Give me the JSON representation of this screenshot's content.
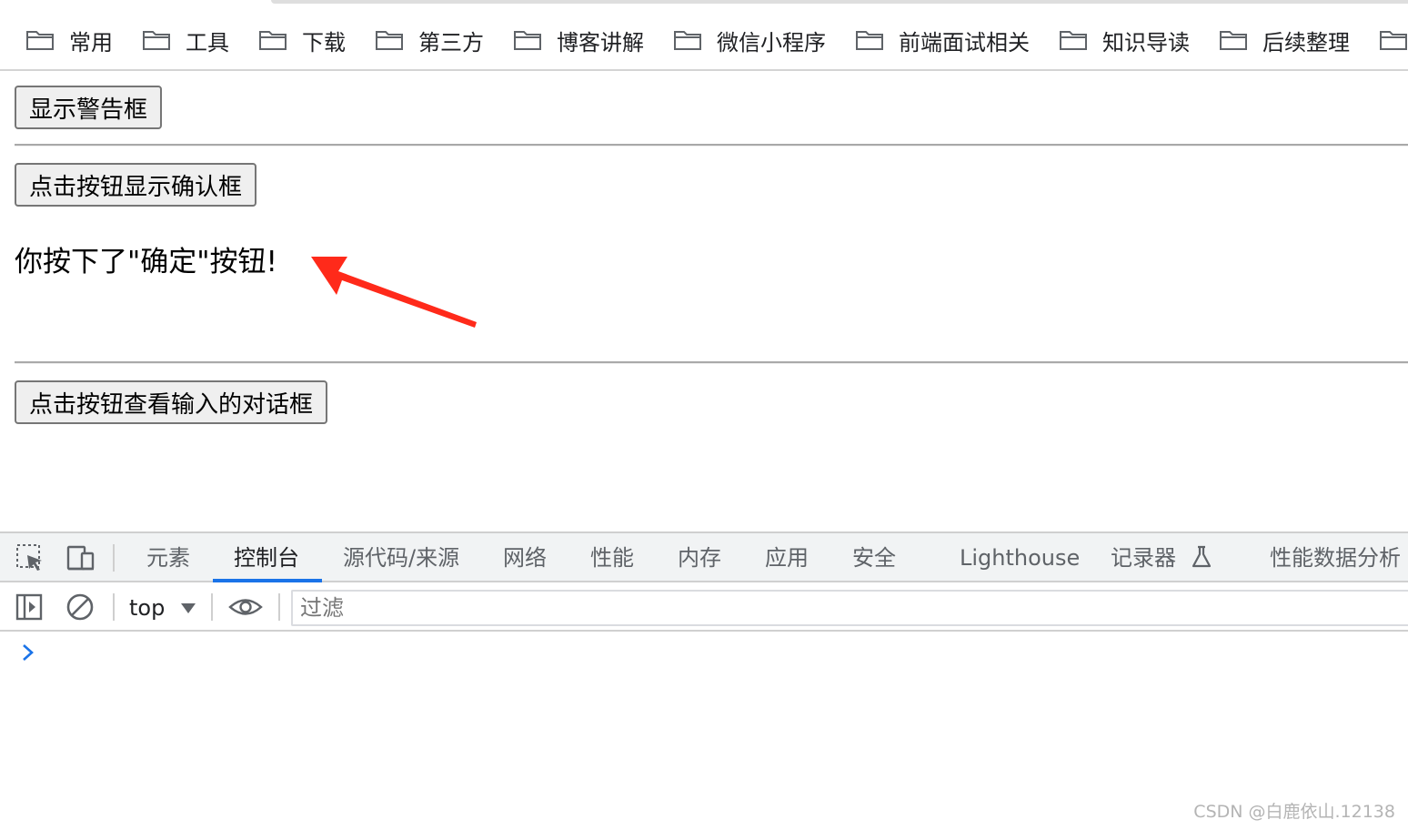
{
  "bookmarks": [
    {
      "label": "常用",
      "icon": "folder-icon"
    },
    {
      "label": "工具",
      "icon": "folder-icon"
    },
    {
      "label": "下载",
      "icon": "folder-icon"
    },
    {
      "label": "第三方",
      "icon": "folder-icon"
    },
    {
      "label": "博客讲解",
      "icon": "folder-icon"
    },
    {
      "label": "微信小程序",
      "icon": "folder-icon"
    },
    {
      "label": "前端面试相关",
      "icon": "folder-icon"
    },
    {
      "label": "知识导读",
      "icon": "folder-icon"
    },
    {
      "label": "后续整理",
      "icon": "folder-icon"
    }
  ],
  "page": {
    "alert_button": "显示警告框",
    "confirm_button": "点击按钮显示确认框",
    "confirm_result": "你按下了\"确定\"按钮!",
    "prompt_button": "点击按钮查看输入的对话框",
    "annotation_arrow_color": "#ff2a1a"
  },
  "devtools": {
    "tabs": [
      {
        "label": "元素"
      },
      {
        "label": "控制台",
        "active": true
      },
      {
        "label": "源代码/来源"
      },
      {
        "label": "网络"
      },
      {
        "label": "性能"
      },
      {
        "label": "内存"
      },
      {
        "label": "应用"
      },
      {
        "label": "安全"
      },
      {
        "label": "Lighthouse"
      },
      {
        "label": "记录器"
      },
      {
        "label": "性能数据分析"
      }
    ],
    "context": "top",
    "filter_placeholder": "过滤",
    "accent_color": "#1a73e8",
    "icons": [
      "inspect-element-icon",
      "device-toolbar-icon",
      "sidebar-toggle-icon",
      "clear-console-icon",
      "eye-icon",
      "flask-icon",
      "prompt-chevron-icon"
    ]
  },
  "watermark": "CSDN @白鹿依山.12138"
}
